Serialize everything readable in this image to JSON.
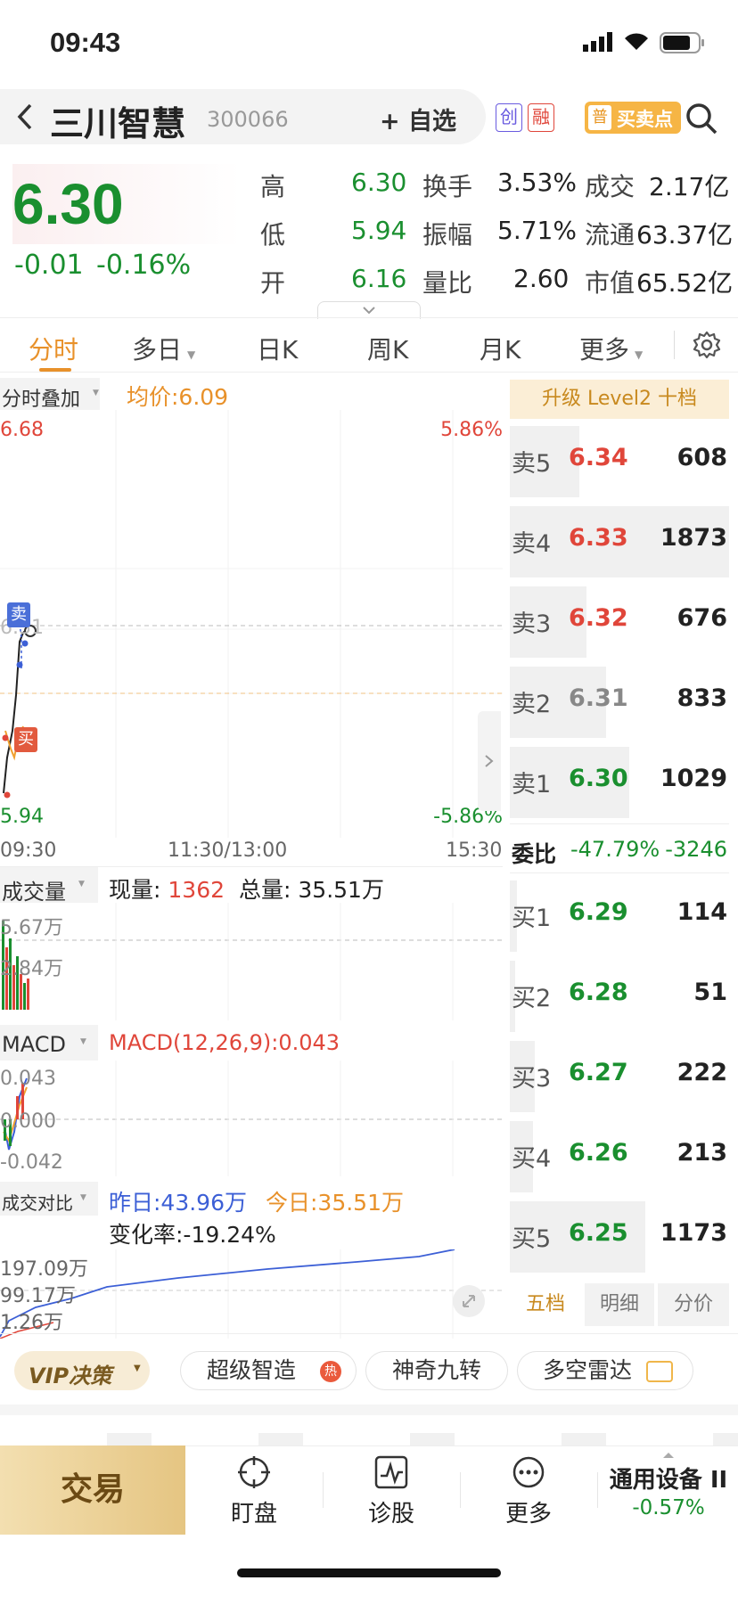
{
  "status": {
    "time": "09:43"
  },
  "header": {
    "name": "三川智慧",
    "code": "300066",
    "add_watch": "自选",
    "tag_chuang": "创",
    "tag_rong": "融",
    "tag_pu": "普",
    "buy_sell_point": "买卖点"
  },
  "quote": {
    "price": "6.30",
    "change": "-0.01",
    "change_pct": "-0.16%",
    "stats": [
      {
        "label": "高",
        "value": "6.30"
      },
      {
        "label": "低",
        "value": "5.94"
      },
      {
        "label": "开",
        "value": "6.16"
      },
      {
        "label": "换手",
        "value": "3.53%"
      },
      {
        "label": "振幅",
        "value": "5.71%"
      },
      {
        "label": "量比",
        "value": "2.60"
      },
      {
        "label": "成交",
        "value": "2.17亿"
      },
      {
        "label": "流通",
        "value": "63.37亿"
      },
      {
        "label": "市值",
        "value": "65.52亿"
      }
    ]
  },
  "tabs": [
    "分时",
    "多日",
    "日K",
    "周K",
    "月K",
    "更多"
  ],
  "intraday": {
    "overlay_label": "分时叠加",
    "avg_price_label": "均价:6.09",
    "y_top": "6.68",
    "y_bottom": "5.94",
    "pct_top": "5.86%",
    "pct_bottom": "-5.86%",
    "t_start": "09:30",
    "t_mid": "11:30/13:00",
    "t_end": "15:30",
    "sell_marker": "卖",
    "buy_marker": "买",
    "mid_label": "6.31"
  },
  "volume": {
    "label": "成交量",
    "now_label": "现量:",
    "now_value": "1362",
    "total_label": "总量:",
    "total_value": "35.51万",
    "y1": "5.67万",
    "y2": "2.84万"
  },
  "macd": {
    "label": "MACD",
    "params": "MACD(12,26,9):0.043",
    "y1": "0.043",
    "y2": "0.000",
    "y3": "-0.042"
  },
  "compare": {
    "label": "成交对比",
    "yesterday": "昨日:43.96万",
    "today": "今日:35.51万",
    "change": "变化率:-19.24%",
    "y1": "197.09万",
    "y2": "99.17万",
    "y3": "1.26万"
  },
  "orderbook": {
    "upgrade": "升级 Level2 十档",
    "asks": [
      {
        "label": "卖5",
        "price": "6.34",
        "vol": "608",
        "fill": 0.28
      },
      {
        "label": "卖4",
        "price": "6.33",
        "vol": "1873",
        "fill": 1.0
      },
      {
        "label": "卖3",
        "price": "6.32",
        "vol": "676",
        "fill": 0.31
      },
      {
        "label": "卖2",
        "price": "6.31",
        "vol": "833",
        "fill": 0.38
      },
      {
        "label": "卖1",
        "price": "6.30",
        "vol": "1029",
        "fill": 0.47
      }
    ],
    "ratio_label": "委比",
    "ratio_pct": "-47.79%",
    "ratio_val": "-3246",
    "bids": [
      {
        "label": "买1",
        "price": "6.29",
        "vol": "114",
        "fill": 0.03
      },
      {
        "label": "买2",
        "price": "6.28",
        "vol": "51",
        "fill": 0.02
      },
      {
        "label": "买3",
        "price": "6.27",
        "vol": "222",
        "fill": 0.1
      },
      {
        "label": "买4",
        "price": "6.26",
        "vol": "213",
        "fill": 0.1
      },
      {
        "label": "买5",
        "price": "6.25",
        "vol": "1173",
        "fill": 0.54
      }
    ],
    "tabs": [
      "五档",
      "明细",
      "分价"
    ]
  },
  "chips": {
    "vip": "VIP决策",
    "c1": "超级智造",
    "c1_badge": "热",
    "c2": "神奇九转",
    "c3": "多空雷达"
  },
  "bottom": {
    "trade": "交易",
    "watch": "盯盘",
    "diagnose": "诊股",
    "more": "更多",
    "sector": "通用设备 II",
    "sector_pct": "-0.57%"
  },
  "colors": {
    "up": "#e0463a",
    "down": "#1a8f2f",
    "accent": "#e8912a",
    "avg": "#f0a030",
    "line": "#3c5fd6"
  }
}
